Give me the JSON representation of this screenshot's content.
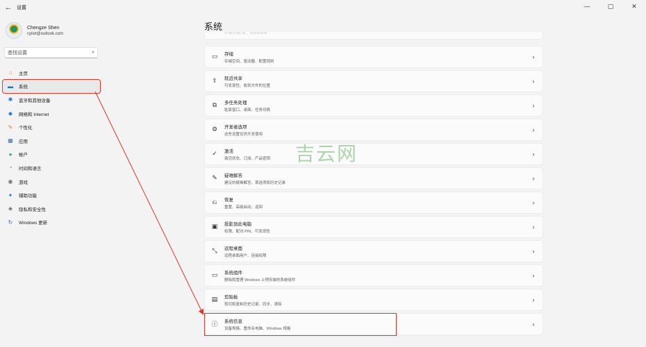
{
  "app": {
    "title": "设置",
    "back_icon": "back-arrow-icon"
  },
  "window_controls": {
    "minimize": "—",
    "maximize": "▢",
    "close": "✕"
  },
  "profile": {
    "name": "Chengze Shen",
    "email": "cyiiot@outlook.com"
  },
  "search": {
    "placeholder": "查找设置"
  },
  "nav": {
    "items": [
      {
        "label": "主页",
        "icon": "home-icon",
        "glyph": "⌂",
        "color": "#e8903a"
      },
      {
        "label": "系统",
        "icon": "monitor-icon",
        "glyph": "▬",
        "color": "#1a6fd6",
        "selected": true
      },
      {
        "label": "蓝牙和其他设备",
        "icon": "bluetooth-icon",
        "glyph": "✱",
        "color": "#1a6fd6"
      },
      {
        "label": "网络和 Internet",
        "icon": "wifi-icon",
        "glyph": "◆",
        "color": "#2a7fd6"
      },
      {
        "label": "个性化",
        "icon": "brush-icon",
        "glyph": "✎",
        "color": "#d67a2a"
      },
      {
        "label": "应用",
        "icon": "apps-icon",
        "glyph": "▦",
        "color": "#4a6fa0"
      },
      {
        "label": "帐户",
        "icon": "account-icon",
        "glyph": "●",
        "color": "#2aa86a"
      },
      {
        "label": "时间和语言",
        "icon": "globe-clock-icon",
        "glyph": "◔",
        "color": "#2a8fd6"
      },
      {
        "label": "游戏",
        "icon": "gamepad-icon",
        "glyph": "◉",
        "color": "#707070"
      },
      {
        "label": "辅助功能",
        "icon": "accessibility-icon",
        "glyph": "✦",
        "color": "#1a6fd6"
      },
      {
        "label": "隐私和安全性",
        "icon": "shield-icon",
        "glyph": "◈",
        "color": "#606060"
      },
      {
        "label": "Windows 更新",
        "icon": "update-icon",
        "glyph": "↻",
        "color": "#1a6fd6"
      }
    ]
  },
  "main": {
    "title": "系统",
    "top_partial_text": "小书(小书) 书… 书书书书书",
    "cards": [
      {
        "title": "存储",
        "subtitle": "存储空间、驱动器、配置规则",
        "icon": "storage-icon",
        "glyph": "▭"
      },
      {
        "title": "就近共享",
        "subtitle": "可发现性、收到文件的位置",
        "icon": "share-icon",
        "glyph": "⇪"
      },
      {
        "title": "多任务处理",
        "subtitle": "贴靠窗口、桌面、任务切换",
        "icon": "multitask-icon",
        "glyph": "⧉"
      },
      {
        "title": "开发者选项",
        "subtitle": "这些设置仅供开发使用",
        "icon": "developer-icon",
        "glyph": "⚙"
      },
      {
        "title": "激活",
        "subtitle": "激活状态、订阅、产品密钥",
        "icon": "activation-icon",
        "glyph": "✓"
      },
      {
        "title": "疑难解答",
        "subtitle": "建议的疑难解答、首选项和历史记录",
        "icon": "wrench-icon",
        "glyph": "✎"
      },
      {
        "title": "恢复",
        "subtitle": "重置、高级启动、返回",
        "icon": "recovery-icon",
        "glyph": "⎌"
      },
      {
        "title": "投影到此电脑",
        "subtitle": "权限、配对 PIN、可发现性",
        "icon": "project-icon",
        "glyph": "▣"
      },
      {
        "title": "远程桌面",
        "subtitle": "远程桌面用户、连接权限",
        "icon": "remote-desktop-icon",
        "glyph": "⤡"
      },
      {
        "title": "系统组件",
        "subtitle": "删除和管理 Windows 上预安装的系统组件",
        "icon": "components-icon",
        "glyph": "▭"
      },
      {
        "title": "剪贴板",
        "subtitle": "剪切和复制历史记录、同步、清除",
        "icon": "clipboard-icon",
        "glyph": "▤"
      },
      {
        "title": "系统信息",
        "subtitle": "设备规格、重命名电脑、Windows 规格",
        "icon": "info-icon",
        "glyph": "ⓘ",
        "highlight": true
      }
    ],
    "chevron": "›"
  },
  "watermark": "吉云网",
  "colors": {
    "accent_red": "#e0352b",
    "background": "#f3f3f3",
    "card": "#fbfbfb"
  }
}
